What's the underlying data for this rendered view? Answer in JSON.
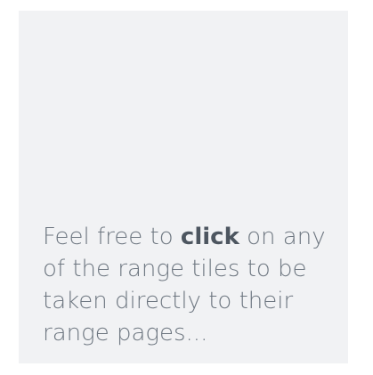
{
  "tile": {
    "text_before": "Feel free to ",
    "emphasis": "click",
    "text_after": " on any of the range tiles to be taken directly to their range pages..."
  },
  "colors": {
    "tile_background": "#f1f2f4",
    "text": "#6e7781",
    "emphasis": "#4d5660"
  }
}
